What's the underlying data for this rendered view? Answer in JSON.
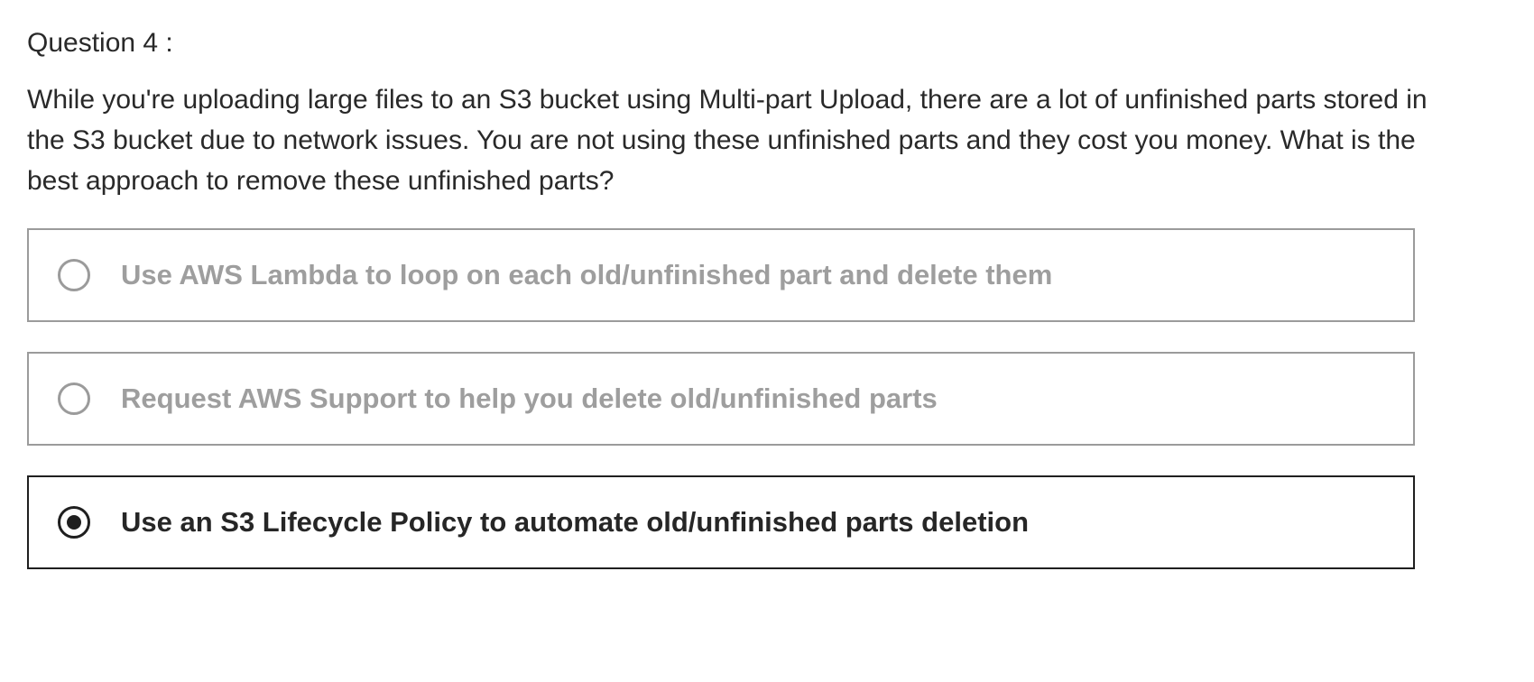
{
  "question": {
    "header": "Question 4 :",
    "text": "While you're uploading large files to an S3 bucket using Multi-part Upload, there are a lot of unfinished parts stored in the S3 bucket due to network issues. You are not using these unfinished parts and they cost you money. What is the best approach to remove these unfinished parts?"
  },
  "options": [
    {
      "label": "Use AWS Lambda to loop on each old/unfinished part and delete them",
      "selected": false
    },
    {
      "label": "Request AWS Support to help you delete old/unfinished parts",
      "selected": false
    },
    {
      "label": "Use an S3 Lifecycle Policy to automate old/unfinished parts deletion",
      "selected": true
    }
  ],
  "colors": {
    "selected_border": "#1f1f1f",
    "unselected_border": "#9b9b9b",
    "unselected_text": "#9e9e9e",
    "selected_text": "#262626"
  }
}
